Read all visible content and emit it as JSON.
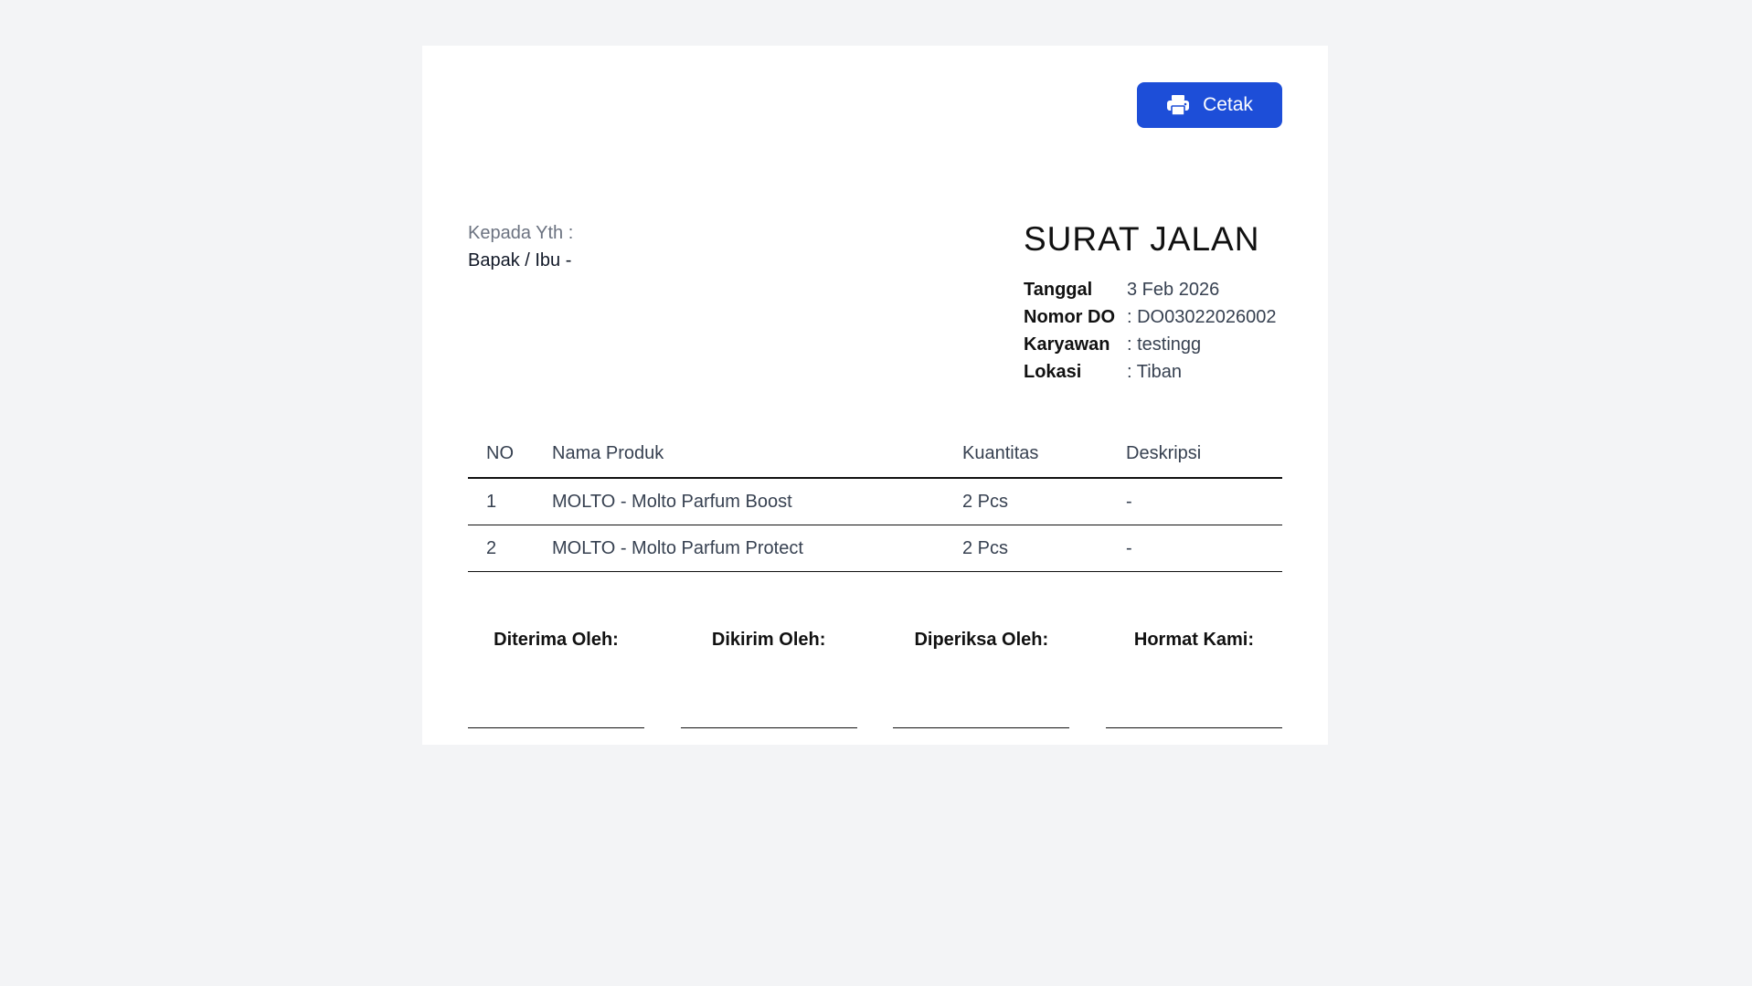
{
  "toolbar": {
    "print_label": "Cetak",
    "print_icon": "printer-icon"
  },
  "recipient": {
    "label": "Kepada Yth :",
    "name": "Bapak / Ibu -"
  },
  "document": {
    "title": "SURAT JALAN",
    "fields": [
      {
        "label": "Tanggal",
        "value": "3 Feb 2026"
      },
      {
        "label": "Nomor DO",
        "value": ": DO03022026002"
      },
      {
        "label": "Karyawan",
        "value": ": testingg"
      },
      {
        "label": "Lokasi",
        "value": ": Tiban"
      }
    ]
  },
  "table": {
    "headers": {
      "no": "NO",
      "name": "Nama Produk",
      "qty": "Kuantitas",
      "desc": "Deskripsi"
    },
    "rows": [
      {
        "no": "1",
        "name": "MOLTO - Molto Parfum Boost",
        "qty": "2 Pcs",
        "desc": "-"
      },
      {
        "no": "2",
        "name": "MOLTO - Molto Parfum Protect",
        "qty": "2 Pcs",
        "desc": "-"
      }
    ]
  },
  "signatures": [
    "Diterima Oleh:",
    "Dikirim Oleh:",
    "Diperiksa Oleh:",
    "Hormat Kami:"
  ],
  "colors": {
    "accent": "#1d4ed8",
    "background": "#f3f4f6",
    "card": "#ffffff"
  }
}
